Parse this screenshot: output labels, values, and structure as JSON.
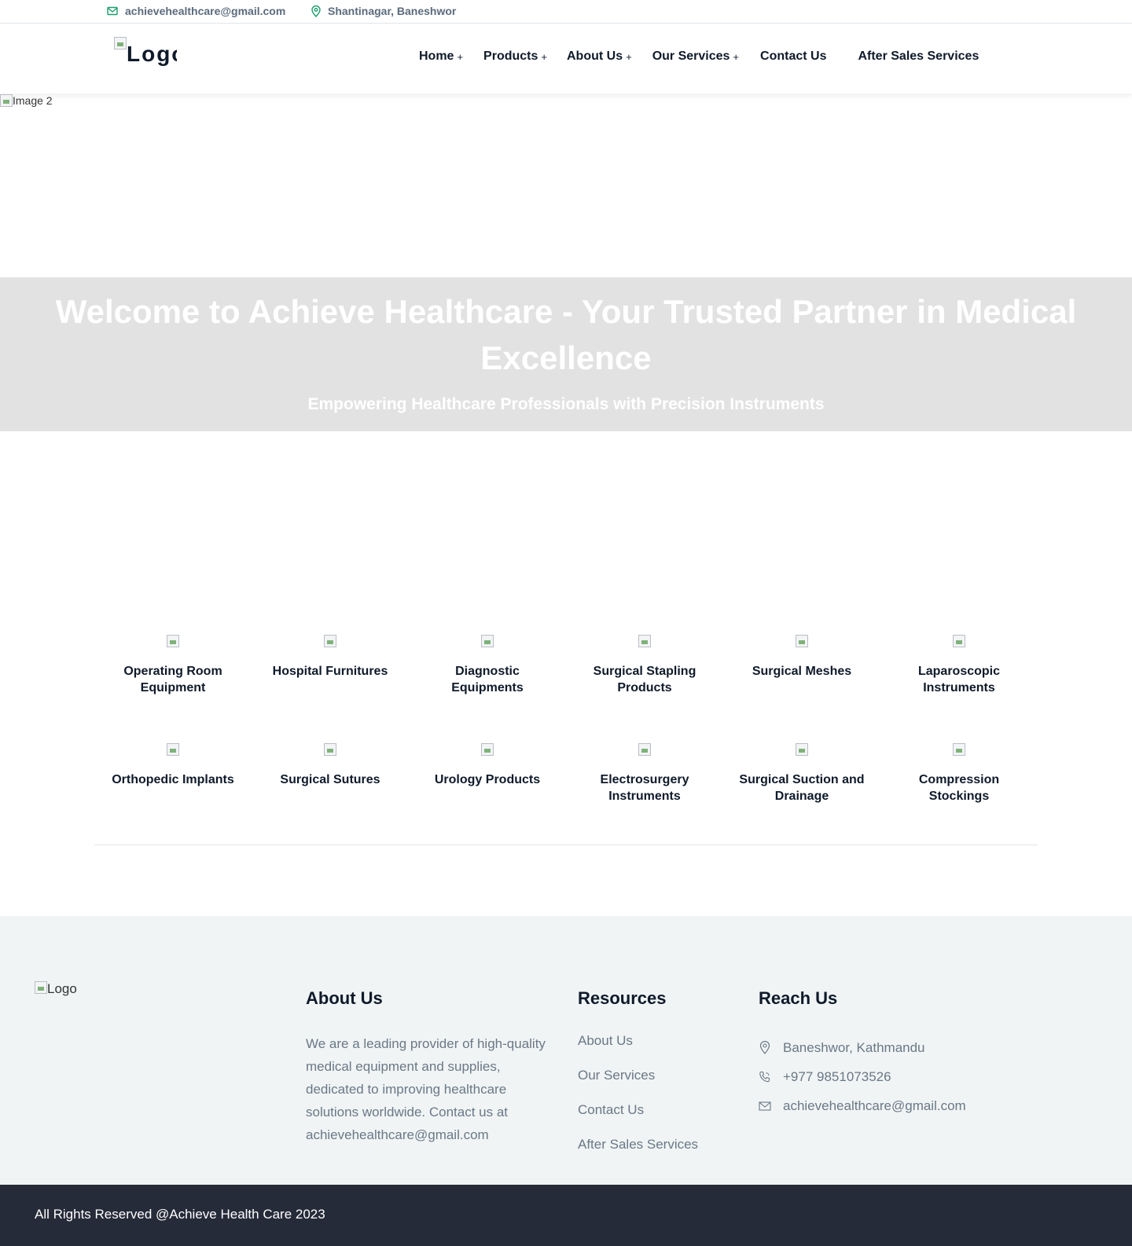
{
  "topbar": {
    "email": "achievehealthcare@gmail.com",
    "location": "Shantinagar, Baneshwor"
  },
  "header": {
    "logo_alt": "Logo",
    "nav": {
      "home": "Home",
      "products": "Products",
      "about": "About Us",
      "services": "Our Services",
      "contact": "Contact Us",
      "after_sales": "After Sales Services",
      "expand_symbol": "+"
    }
  },
  "hero": {
    "image_alt": "Image 2",
    "title": "Welcome to Achieve Healthcare - Your Trusted Partner in Medical Excellence",
    "subtitle": "Empowering Healthcare Professionals with Precision Instruments"
  },
  "categories": [
    "Operating Room Equipment",
    "Hospital Furnitures",
    "Diagnostic Equipments",
    "Surgical Stapling Products",
    "Surgical Meshes",
    "Laparoscopic Instruments",
    "Orthopedic Implants",
    "Surgical Sutures",
    "Urology Products",
    "Electrosurgery Instruments",
    "Surgical Suction and Drainage",
    "Compression Stockings"
  ],
  "footer": {
    "logo_alt": "Logo",
    "about_title": "About Us",
    "about_text": "We are a leading provider of high-quality medical equipment and supplies, dedicated to improving healthcare solutions worldwide. Contact us at achievehealthcare@gmail.com",
    "resources_title": "Resources",
    "resources": [
      "About Us",
      "Our Services",
      "Contact Us",
      "After Sales Services"
    ],
    "reach_title": "Reach Us",
    "address": "Baneshwor, Kathmandu",
    "phone": "+977 9851073526",
    "email": "achievehealthcare@gmail.com",
    "copyright": "All Rights Reserved @Achieve Health Care 2023"
  },
  "colors": {
    "accent_green": "#1a9c6b",
    "hero_band": "#e2e2e2",
    "footer_bg": "#f0f4f5",
    "copyright_bg": "#262b39"
  }
}
